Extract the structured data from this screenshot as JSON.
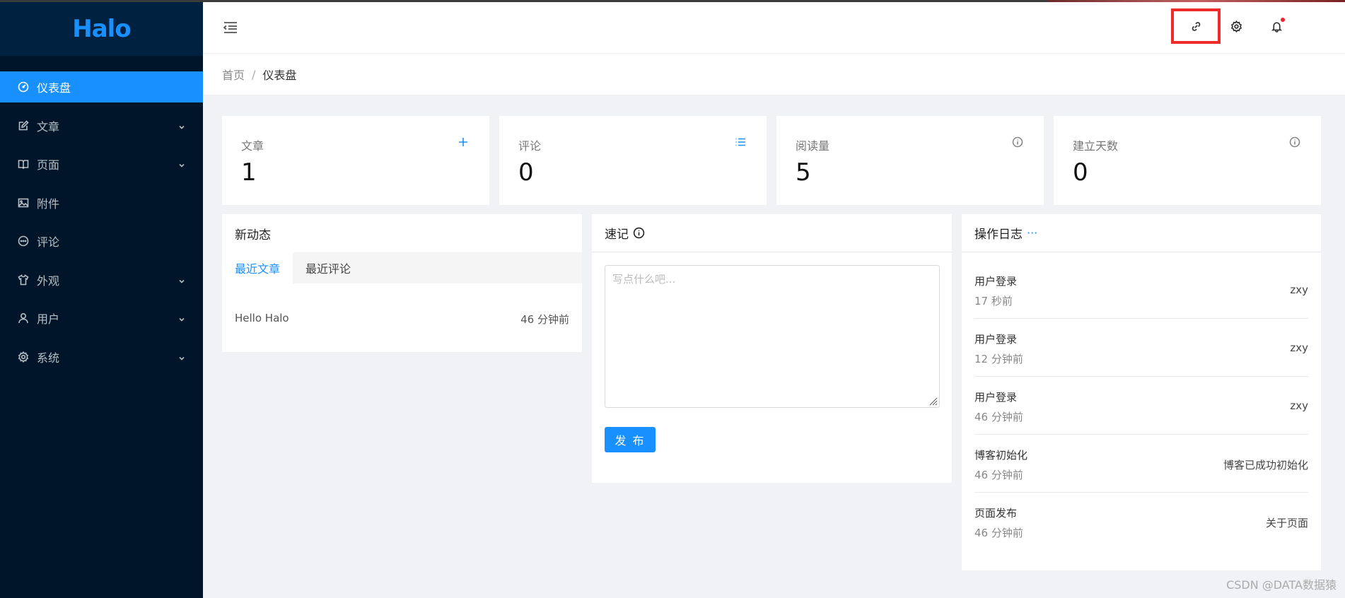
{
  "app": {
    "logo": "Halo"
  },
  "sidebar": {
    "items": [
      {
        "label": "仪表盘",
        "icon": "dashboard-icon",
        "active": true
      },
      {
        "label": "文章",
        "icon": "edit-icon",
        "expandable": true
      },
      {
        "label": "页面",
        "icon": "book-icon",
        "expandable": true
      },
      {
        "label": "附件",
        "icon": "picture-icon"
      },
      {
        "label": "评论",
        "icon": "message-icon"
      },
      {
        "label": "外观",
        "icon": "skin-icon",
        "expandable": true
      },
      {
        "label": "用户",
        "icon": "user-icon",
        "expandable": true
      },
      {
        "label": "系统",
        "icon": "setting-icon",
        "expandable": true
      }
    ]
  },
  "header": {
    "icons": [
      "menu-fold-icon",
      "link-icon",
      "gear-icon",
      "bell-icon"
    ],
    "highlight_color": "#ee2c2c"
  },
  "breadcrumb": {
    "home": "首页",
    "separator": "/",
    "current": "仪表盘"
  },
  "stats": [
    {
      "title": "文章",
      "value": "1",
      "action_icon": "plus-icon"
    },
    {
      "title": "评论",
      "value": "0",
      "action_icon": "unordered-list-icon"
    },
    {
      "title": "阅读量",
      "value": "5",
      "action_icon": "info-circle-icon"
    },
    {
      "title": "建立天数",
      "value": "0",
      "action_icon": "info-circle-icon"
    }
  ],
  "activity": {
    "title": "新动态",
    "tabs": [
      "最近文章",
      "最近评论"
    ],
    "posts": [
      {
        "title": "Hello Halo",
        "time": "46 分钟前"
      }
    ]
  },
  "journal": {
    "title": "速记",
    "placeholder": "写点什么吧...",
    "publish_label": "发 布"
  },
  "logs": {
    "title": "操作日志",
    "more": "···",
    "items": [
      {
        "type": "用户登录",
        "time": "17 秒前",
        "content": "zxy"
      },
      {
        "type": "用户登录",
        "time": "12 分钟前",
        "content": "zxy"
      },
      {
        "type": "用户登录",
        "time": "46 分钟前",
        "content": "zxy"
      },
      {
        "type": "博客初始化",
        "time": "46 分钟前",
        "content": "博客已成功初始化"
      },
      {
        "type": "页面发布",
        "time": "46 分钟前",
        "content": "关于页面"
      }
    ]
  },
  "watermark": "CSDN @DATA数据猿",
  "colors": {
    "primary": "#1890ff",
    "sidebar_bg": "#001529",
    "logo_bg": "#002140",
    "notify": "#f5222d"
  }
}
